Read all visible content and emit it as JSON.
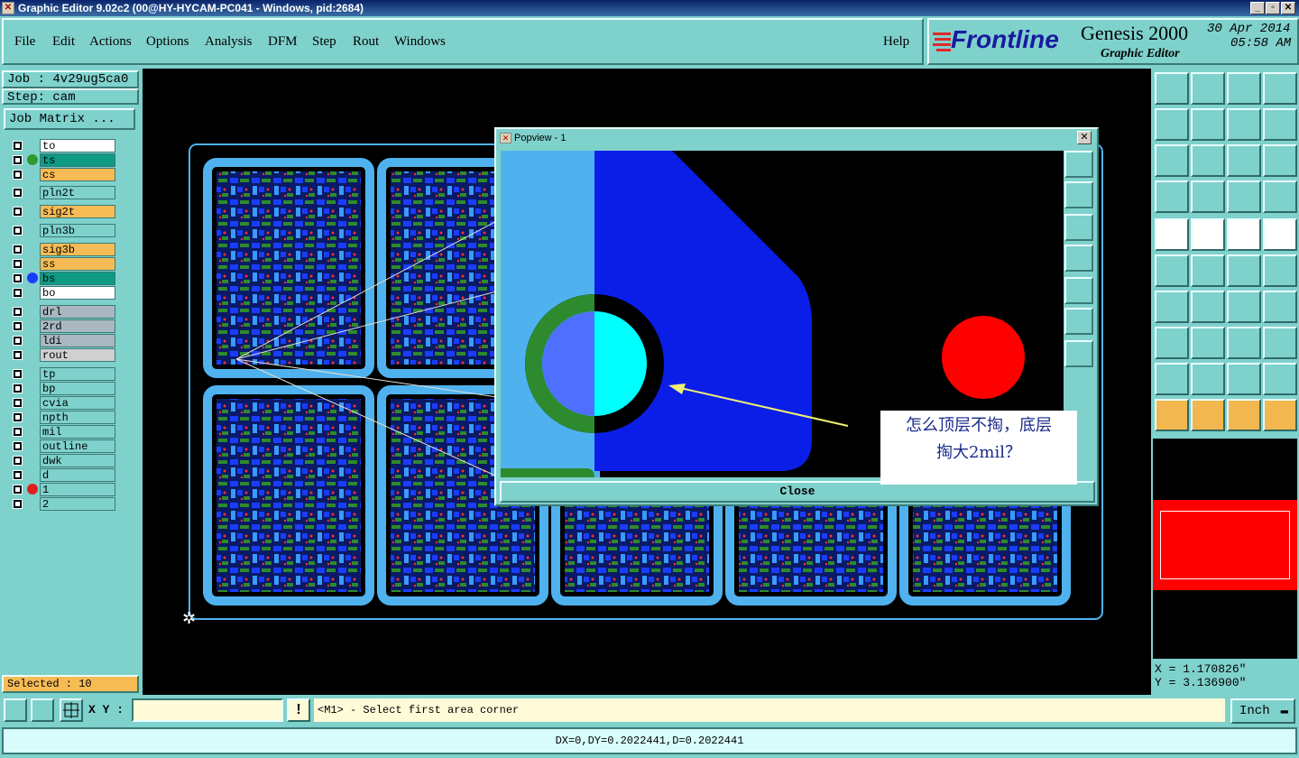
{
  "window": {
    "title": "Graphic Editor 9.02c2 (00@HY-HYCAM-PC041 - Windows, pid:2684)"
  },
  "menu": {
    "items": [
      "File",
      "Edit",
      "Actions",
      "Options",
      "Analysis",
      "DFM",
      "Step",
      "Rout",
      "Windows"
    ],
    "help": "Help"
  },
  "logo": {
    "brand": "Frontline",
    "product": "Genesis 2000",
    "subtitle": "Graphic Editor",
    "date": "30 Apr 2014",
    "time": "05:58 AM"
  },
  "job": {
    "job_label": "Job : 4v29ug5ca0",
    "step_label": "Step: cam",
    "matrix_button": "Job Matrix ..."
  },
  "layers": [
    {
      "name": "to",
      "color": "#ffffff",
      "dot": ""
    },
    {
      "name": "ts",
      "color": "#0e9a83",
      "dot": "#2e9a2e"
    },
    {
      "name": "cs",
      "color": "#f7bb55",
      "dot": ""
    },
    {
      "name": "pln2t",
      "color": "#7fd1cc",
      "dot": ""
    },
    {
      "name": "sig2t",
      "color": "#f7bb55",
      "dot": ""
    },
    {
      "name": "pln3b",
      "color": "#7fd1cc",
      "dot": ""
    },
    {
      "name": "sig3b",
      "color": "#f7bb55",
      "dot": ""
    },
    {
      "name": "ss",
      "color": "#f7bb55",
      "dot": ""
    },
    {
      "name": "bs",
      "color": "#0e9a83",
      "dot": "#1a3cff"
    },
    {
      "name": "bo",
      "color": "#ffffff",
      "dot": ""
    },
    {
      "name": "drl",
      "color": "#a9b8c0",
      "dot": ""
    },
    {
      "name": "2rd",
      "color": "#a9b8c0",
      "dot": ""
    },
    {
      "name": "ldi",
      "color": "#a9b8c0",
      "dot": ""
    },
    {
      "name": "rout",
      "color": "#d0d0d0",
      "dot": ""
    },
    {
      "name": "tp",
      "color": "#7fd1cc",
      "dot": ""
    },
    {
      "name": "bp",
      "color": "#7fd1cc",
      "dot": ""
    },
    {
      "name": "cvia",
      "color": "#7fd1cc",
      "dot": ""
    },
    {
      "name": "npth",
      "color": "#7fd1cc",
      "dot": ""
    },
    {
      "name": "mil",
      "color": "#7fd1cc",
      "dot": ""
    },
    {
      "name": "outline",
      "color": "#7fd1cc",
      "dot": ""
    },
    {
      "name": "dwk",
      "color": "#7fd1cc",
      "dot": ""
    },
    {
      "name": "d",
      "color": "#7fd1cc",
      "dot": ""
    },
    {
      "name": "1",
      "color": "#7fd1cc",
      "dot": "#e02020"
    },
    {
      "name": "2",
      "color": "#7fd1cc",
      "dot": ""
    }
  ],
  "selected": "Selected : 10",
  "popview": {
    "title": "Popview - 1",
    "close_label": "Close",
    "note_line1": "怎么顶层不掏，底层",
    "note_line2": "掏大2mil？"
  },
  "coords": {
    "x": "X = 1.170826\"",
    "y": "Y = 3.136900\""
  },
  "statusbar": {
    "xy_label": "X Y :",
    "xy_value": "",
    "prompt": "<M1> - Select first area corner",
    "units": "Inch"
  },
  "info": "DX=0,DY=0.2022441,D=0.2022441",
  "colors": {
    "panel": "#7fd1cc",
    "canvas": "#000000",
    "copper_blue": "#1a3cff",
    "outline_blue": "#4fb2ef",
    "pad_red": "#ff0000"
  }
}
